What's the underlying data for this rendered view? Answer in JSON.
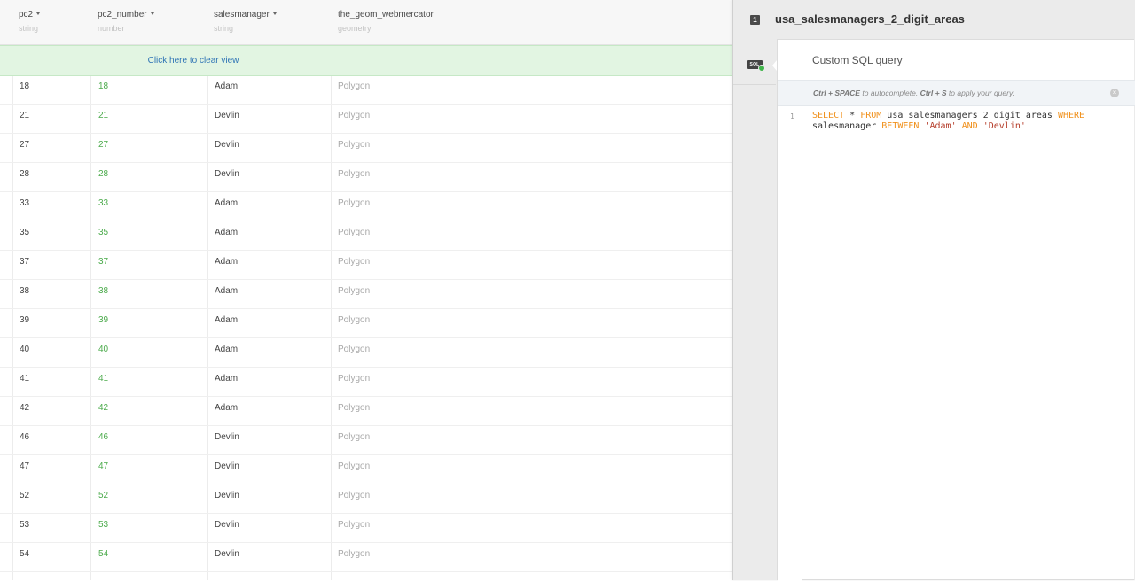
{
  "table": {
    "columns": [
      {
        "name": "pc2",
        "type": "string"
      },
      {
        "name": "pc2_number",
        "type": "number"
      },
      {
        "name": "salesmanager",
        "type": "string"
      },
      {
        "name": "the_geom_webmercator",
        "type": "geometry"
      }
    ],
    "clear_view_label": "Click here to clear view",
    "rows": [
      [
        "18",
        "18",
        "Adam",
        "Polygon"
      ],
      [
        "21",
        "21",
        "Devlin",
        "Polygon"
      ],
      [
        "27",
        "27",
        "Devlin",
        "Polygon"
      ],
      [
        "28",
        "28",
        "Devlin",
        "Polygon"
      ],
      [
        "33",
        "33",
        "Adam",
        "Polygon"
      ],
      [
        "35",
        "35",
        "Adam",
        "Polygon"
      ],
      [
        "37",
        "37",
        "Adam",
        "Polygon"
      ],
      [
        "38",
        "38",
        "Adam",
        "Polygon"
      ],
      [
        "39",
        "39",
        "Adam",
        "Polygon"
      ],
      [
        "40",
        "40",
        "Adam",
        "Polygon"
      ],
      [
        "41",
        "41",
        "Adam",
        "Polygon"
      ],
      [
        "42",
        "42",
        "Adam",
        "Polygon"
      ],
      [
        "46",
        "46",
        "Devlin",
        "Polygon"
      ],
      [
        "47",
        "47",
        "Devlin",
        "Polygon"
      ],
      [
        "52",
        "52",
        "Devlin",
        "Polygon"
      ],
      [
        "53",
        "53",
        "Devlin",
        "Polygon"
      ],
      [
        "54",
        "54",
        "Devlin",
        "Polygon"
      ]
    ]
  },
  "panel": {
    "layer_number": "1",
    "title": "usa_salesmanagers_2_digit_areas",
    "sql_tab_label": "SQL",
    "card_title": "Custom SQL query",
    "hint": {
      "key1": "Ctrl + SPACE",
      "text1": " to autocomplete. ",
      "key2": "Ctrl + S",
      "text2": " to apply your query."
    },
    "close_symbol": "×",
    "line_number": "1",
    "query_tokens": [
      {
        "t": "SELECT",
        "k": "kw"
      },
      {
        "t": " * ",
        "k": "plain"
      },
      {
        "t": "FROM",
        "k": "kw"
      },
      {
        "t": " usa_salesmanagers_2_digit_areas ",
        "k": "plain"
      },
      {
        "t": "WHERE",
        "k": "kw"
      },
      {
        "t": " salesmanager ",
        "k": "plain"
      },
      {
        "t": "BETWEEN",
        "k": "kw"
      },
      {
        "t": " ",
        "k": "plain"
      },
      {
        "t": "'Adam'",
        "k": "str"
      },
      {
        "t": " ",
        "k": "plain"
      },
      {
        "t": "AND",
        "k": "kw"
      },
      {
        "t": " ",
        "k": "plain"
      },
      {
        "t": "'Devlin'",
        "k": "str"
      }
    ]
  }
}
